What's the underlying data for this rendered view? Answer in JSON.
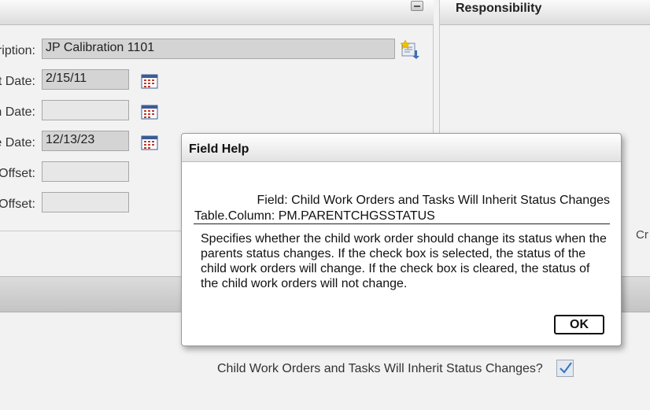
{
  "form": {
    "description_label": "ription:",
    "description_value": "JP Calibration 1101",
    "start_date_label": "t Date:",
    "start_date_value": "2/15/11",
    "second_date_label": "n Date:",
    "second_date_value": "",
    "third_date_label": "e Date:",
    "third_date_value": "12/13/23",
    "offset1_label": "Offset:",
    "offset1_value": "",
    "offset2_label": "Offset:",
    "offset2_value": ""
  },
  "responsibility": {
    "title": "Responsibility",
    "partial_text": "Cr"
  },
  "lower": {
    "inherit_label": "Child Work Orders and Tasks Will Inherit Status Changes?",
    "inherit_checked": true
  },
  "dialog": {
    "title": "Field Help",
    "field_line": "Field: Child Work Orders and Tasks Will Inherit Status Changes",
    "column_line": "Table.Column: PM.PARENTCHGSSTATUS",
    "description": "Specifies whether the child work order should change its status when the parents status changes. If the check box is selected, the status of the child work orders will change. If the check box is cleared, the status of the child work orders will not change.",
    "ok_label": "OK"
  }
}
